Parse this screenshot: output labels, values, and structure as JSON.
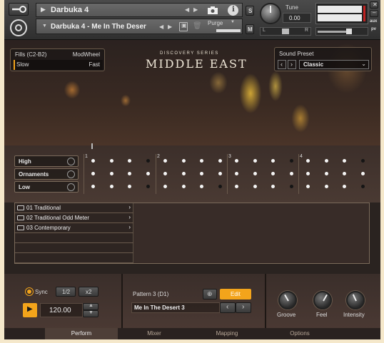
{
  "header": {
    "instrument_name": "Darbuka 4",
    "snapshot_name": "Darbuka 4 - Me In The Deser",
    "purge_label": "Purge",
    "tune_label": "Tune",
    "tune_value": "0.00",
    "s_label": "S",
    "m_label": "M",
    "aux_label": "aux",
    "pv_label": "pv",
    "l_label": "L",
    "r_label": "R"
  },
  "hero": {
    "series": "DISCOVERY SERIES",
    "title": "MIDDLE EAST",
    "fills_label": "Fills (C2-B2)",
    "modwheel_label": "ModWheel",
    "slow_label": "Slow",
    "fast_label": "Fast",
    "preset_label": "Sound Preset",
    "preset_value": "Classic"
  },
  "grid": {
    "rows": [
      "High",
      "Ornaments",
      "Low"
    ],
    "beats": [
      "1",
      "2",
      "3",
      "4"
    ],
    "cells": [
      [
        1,
        1,
        1,
        0,
        1,
        1,
        1,
        1,
        1,
        1,
        1,
        0,
        1,
        1,
        1,
        0
      ],
      [
        1,
        1,
        1,
        1,
        1,
        1,
        1,
        1,
        1,
        1,
        1,
        1,
        1,
        1,
        1,
        1
      ],
      [
        1,
        1,
        1,
        0,
        1,
        1,
        1,
        0,
        1,
        1,
        1,
        0,
        1,
        1,
        1,
        0
      ]
    ]
  },
  "browser": {
    "items": [
      "01 Traditional",
      "02 Traditional Odd Meter",
      "03 Contemporary"
    ]
  },
  "bottom": {
    "sync_label": "Sync",
    "half_label": "1/2",
    "double_label": "x2",
    "tempo": "120.00",
    "pattern_label": "Pattern 3 (D1)",
    "edit_label": "Edit",
    "pattern_name": "Me In The Desert 3",
    "groove_label": "Groove",
    "feel_label": "Feel",
    "intensity_label": "Intensity"
  },
  "tabs": [
    "Perform",
    "Mixer",
    "Mapping",
    "Options"
  ],
  "colors": {
    "accent": "#f3a41b",
    "background": "#2a2320"
  }
}
